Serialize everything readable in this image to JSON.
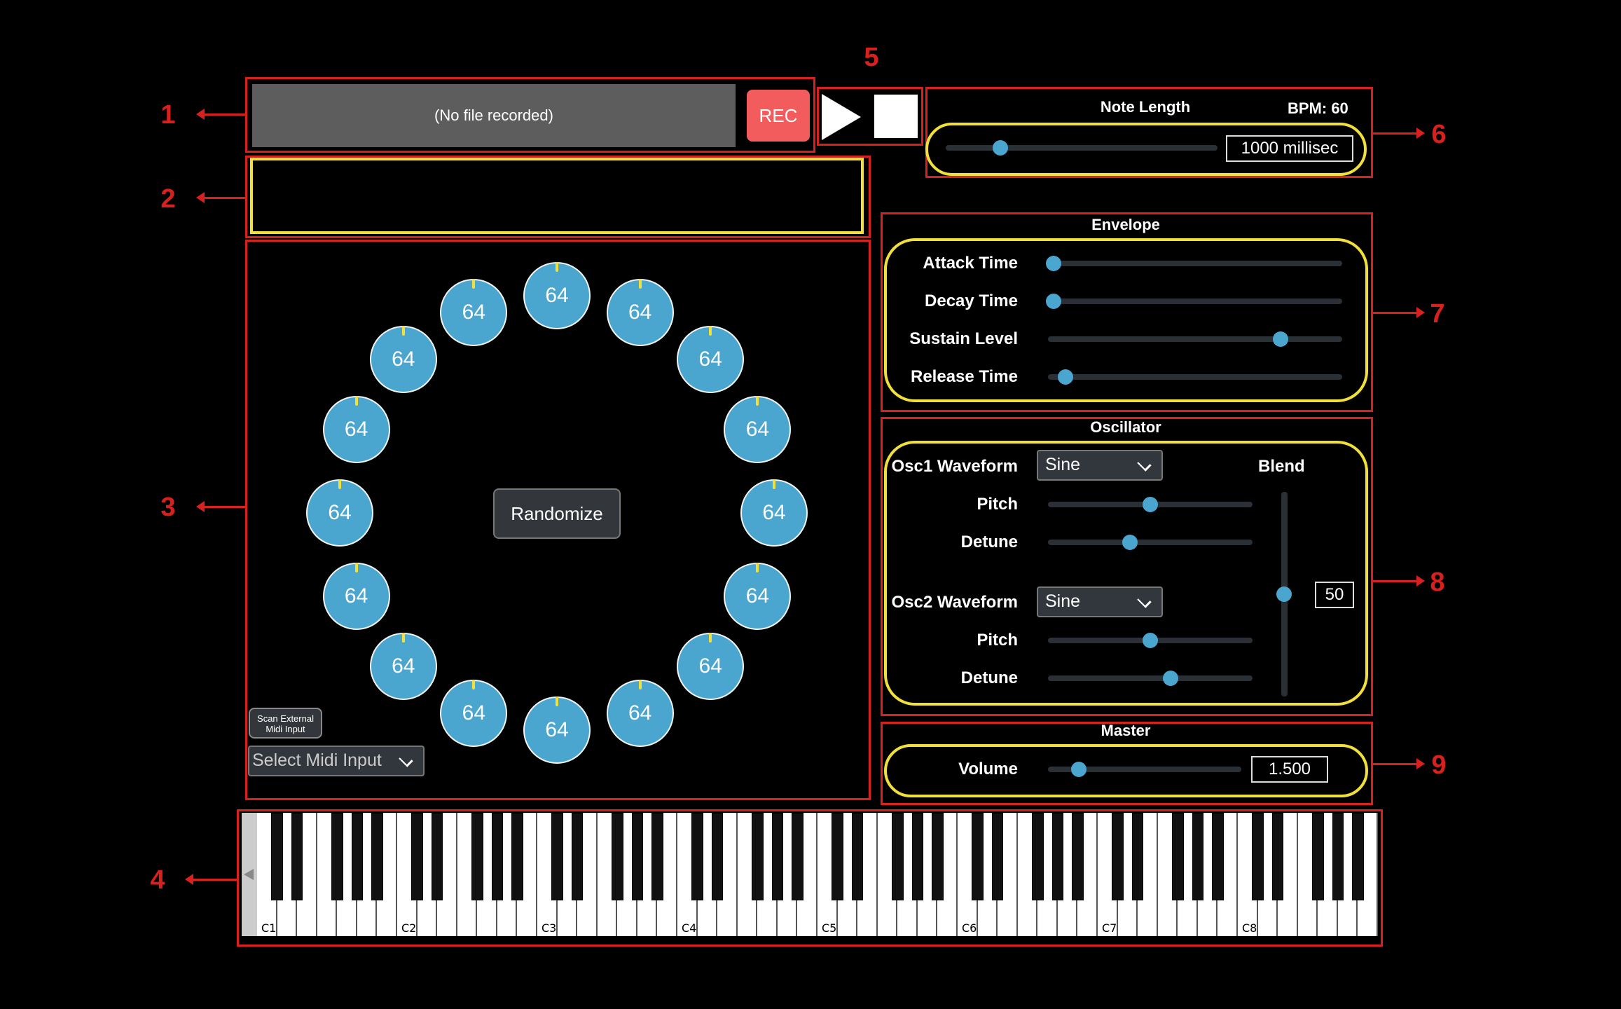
{
  "annotations": [
    "1",
    "2",
    "3",
    "4",
    "5",
    "6",
    "7",
    "8",
    "9"
  ],
  "recorder": {
    "file_label": "(No file recorded)",
    "rec_label": "REC"
  },
  "transport": {
    "play": "play-icon",
    "stop": "stop-icon"
  },
  "note_length": {
    "title": "Note Length",
    "bpm": "BPM: 60",
    "value": "1000 millisec",
    "slider_fraction": 0.2
  },
  "envelope": {
    "title": "Envelope",
    "params": [
      {
        "label": "Attack Time",
        "fraction": 0.02
      },
      {
        "label": "Decay Time",
        "fraction": 0.02
      },
      {
        "label": "Sustain Level",
        "fraction": 0.79
      },
      {
        "label": "Release Time",
        "fraction": 0.06
      }
    ]
  },
  "oscillator": {
    "title": "Oscillator",
    "osc1": {
      "label": "Osc1 Waveform",
      "value": "Sine",
      "pitch_label": "Pitch",
      "pitch": 0.5,
      "detune_label": "Detune",
      "detune": 0.4
    },
    "osc2": {
      "label": "Osc2 Waveform",
      "value": "Sine",
      "pitch_label": "Pitch",
      "pitch": 0.5,
      "detune_label": "Detune",
      "detune": 0.6
    },
    "blend_label": "Blend",
    "blend_value": "50",
    "blend_fraction": 0.5
  },
  "master": {
    "title": "Master",
    "volume_label": "Volume",
    "volume_value": "1.500",
    "volume_fraction": 0.16
  },
  "sequencer": {
    "randomize_label": "Randomize",
    "knob_values": [
      "64",
      "64",
      "64",
      "64",
      "64",
      "64",
      "64",
      "64",
      "64",
      "64",
      "64",
      "64",
      "64",
      "64",
      "64",
      "64"
    ]
  },
  "midi": {
    "scan_label_1": "Scan External",
    "scan_label_2": "Midi Input",
    "select_label": "Select Midi Input"
  },
  "keyboard": {
    "octave_labels": [
      "C1",
      "C2",
      "C3",
      "C4",
      "C5",
      "C6",
      "C7",
      "C8"
    ]
  },
  "colors": {
    "accent": "#4aa5cf",
    "highlight": "#f2e03a",
    "annotation": "#d8211d",
    "rec": "#f25c5c"
  }
}
